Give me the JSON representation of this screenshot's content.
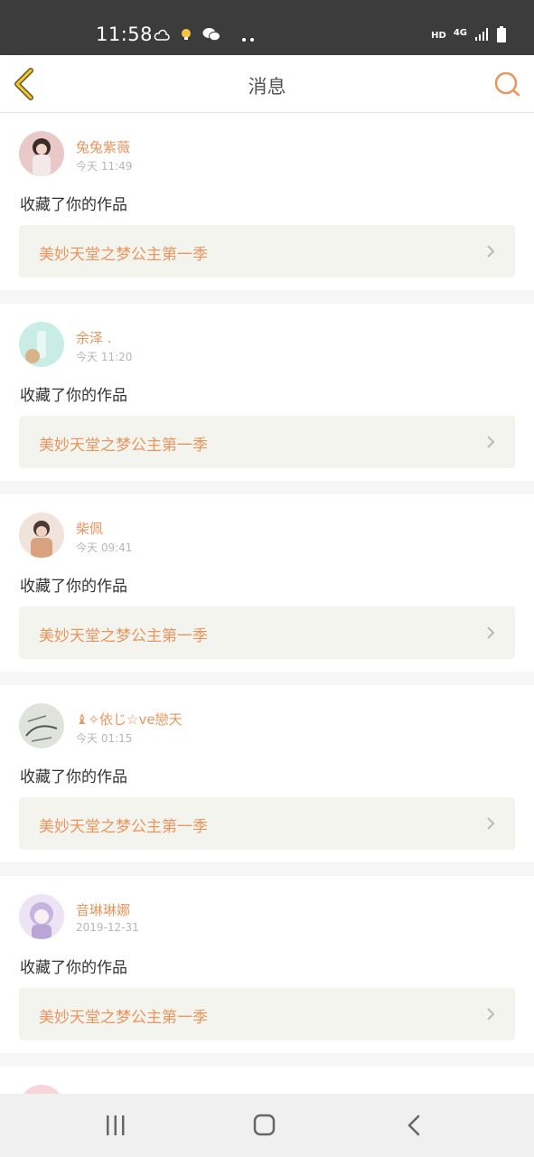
{
  "status_bar": {
    "time": "11:58",
    "hd": "HD",
    "network": "4G",
    "icons_left": [
      "weather-icon",
      "notification-icon",
      "wechat-icon",
      "more-dots-icon"
    ],
    "icons_right": [
      "signal-icon",
      "battery-icon"
    ]
  },
  "header": {
    "title": "消息",
    "back_icon": "chevron-left-icon",
    "search_icon": "search-icon",
    "accent_color": "#e8955e"
  },
  "messages": [
    {
      "username": "兔兔紫薇",
      "time": "今天 11:49",
      "action": "收藏了你的作品",
      "work_title": "美妙天堂之梦公主第一季",
      "avatar_color": "#d79c9c"
    },
    {
      "username": "余泽 .",
      "time": "今天 11:20",
      "action": "收藏了你的作品",
      "work_title": "美妙天堂之梦公主第一季",
      "avatar_color": "#9fd6d0"
    },
    {
      "username": "柴佩",
      "time": "今天 09:41",
      "action": "收藏了你的作品",
      "work_title": "美妙天堂之梦公主第一季",
      "avatar_color": "#c9a489"
    },
    {
      "username": "♝✧依じ☆ve戀天",
      "time": "今天 01:15",
      "action": "收藏了你的作品",
      "work_title": "美妙天堂之梦公主第一季",
      "avatar_color": "#9aa89a"
    },
    {
      "username": "音琳琳娜",
      "time": "2019-12-31",
      "action": "收藏了你的作品",
      "work_title": "美妙天堂之梦公主第一季",
      "avatar_color": "#c8b4dc"
    }
  ],
  "nav_bar": {
    "icons": [
      "recent-apps-icon",
      "home-icon",
      "back-icon"
    ]
  }
}
